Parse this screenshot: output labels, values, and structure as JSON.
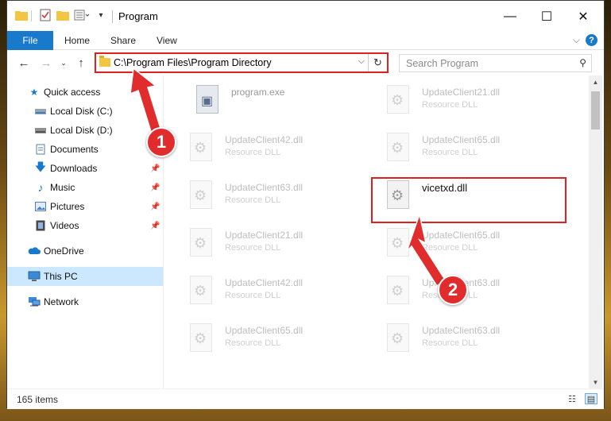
{
  "window": {
    "title": "Program",
    "minimize": "—",
    "maximize": "☐",
    "close": "✕"
  },
  "ribbon": {
    "file": "File",
    "tabs": [
      "Home",
      "Share",
      "View"
    ],
    "help": "?"
  },
  "nav": {
    "address": "C:\\Program Files\\Program Directory",
    "search_placeholder": "Search Program"
  },
  "sidebar": {
    "items": [
      {
        "label": "Quick access",
        "icon": "star-icon"
      },
      {
        "label": "Local Disk (C:)",
        "icon": "drive-icon"
      },
      {
        "label": "Local Disk (D:)",
        "icon": "drive-icon"
      },
      {
        "label": "Documents",
        "icon": "documents-icon"
      },
      {
        "label": "Downloads",
        "icon": "downloads-icon"
      },
      {
        "label": "Music",
        "icon": "music-icon"
      },
      {
        "label": "Pictures",
        "icon": "pictures-icon"
      },
      {
        "label": "Videos",
        "icon": "videos-icon"
      },
      {
        "label": "OneDrive",
        "icon": "cloud-icon"
      },
      {
        "label": "This PC",
        "icon": "pc-icon"
      },
      {
        "label": "Network",
        "icon": "network-icon"
      }
    ]
  },
  "files": [
    {
      "name": "program.exe",
      "type": ""
    },
    {
      "name": "UpdateClient21.dll",
      "type": "Resource DLL"
    },
    {
      "name": "UpdateClient42.dll",
      "type": "Resource DLL"
    },
    {
      "name": "UpdateClient65.dll",
      "type": "Resource DLL"
    },
    {
      "name": "UpdateClient63.dll",
      "type": "Resource DLL"
    },
    {
      "name": "vicetxd.dll",
      "type": ""
    },
    {
      "name": "UpdateClient21.dll",
      "type": "Resource DLL"
    },
    {
      "name": "UpdateClient65.dll",
      "type": "Resource DLL"
    },
    {
      "name": "UpdateClient42.dll",
      "type": "Resource DLL"
    },
    {
      "name": "UpdateClient63.dll",
      "type": "Resource DLL"
    },
    {
      "name": "UpdateClient65.dll",
      "type": "Resource DLL"
    },
    {
      "name": "UpdateClient63.dll",
      "type": "Resource DLL"
    }
  ],
  "status": {
    "count": "165 items"
  },
  "annotations": {
    "step1": "1",
    "step2": "2",
    "color": "#e02020"
  }
}
